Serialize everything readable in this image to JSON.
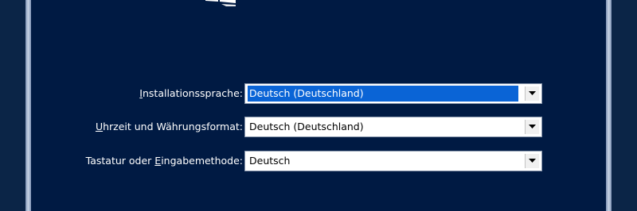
{
  "setup": {
    "fields": [
      {
        "label_accel": "I",
        "label_rest": "nstallationssprache:",
        "value": "Deutsch (Deutschland)",
        "focused": true
      },
      {
        "label_accel": "U",
        "label_rest": "hrzeit und Währungsformat:",
        "value": "Deutsch (Deutschland)",
        "focused": false
      },
      {
        "label_pre": "Tastatur oder ",
        "label_accel": "E",
        "label_rest": "ingabemethode:",
        "value": "Deutsch",
        "focused": false
      }
    ]
  },
  "colors": {
    "background": "#001a43",
    "selection": "#0a64d6",
    "frame": "#c8d4e6"
  },
  "icons": {
    "dropdown": "chevron-down-icon",
    "logo": "windows-logo-icon"
  }
}
